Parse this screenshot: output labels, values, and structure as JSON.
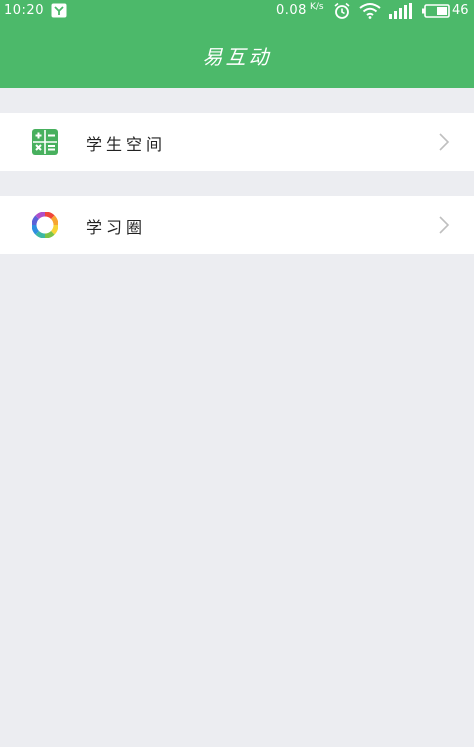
{
  "status_bar": {
    "time": "10:20",
    "net_speed": "0.08",
    "net_speed_unit": "K/s",
    "battery_level": "46",
    "icons": [
      "app-notification-icon",
      "alarm-icon",
      "wifi-icon",
      "signal-icon",
      "battery-icon"
    ]
  },
  "app_bar": {
    "title": "易互动"
  },
  "menu": {
    "items": [
      {
        "label": "学生空间",
        "icon": "calculator-icon",
        "chevron": "chevron-right-icon"
      },
      {
        "label": "学习圈",
        "icon": "color-ring-icon",
        "chevron": "chevron-right-icon"
      }
    ]
  },
  "colors": {
    "brand_green": "#4cb96a",
    "background": "#ecedf1",
    "row_background": "#ffffff",
    "icon_green": "#48b05e",
    "chevron": "#bfbfbf"
  }
}
